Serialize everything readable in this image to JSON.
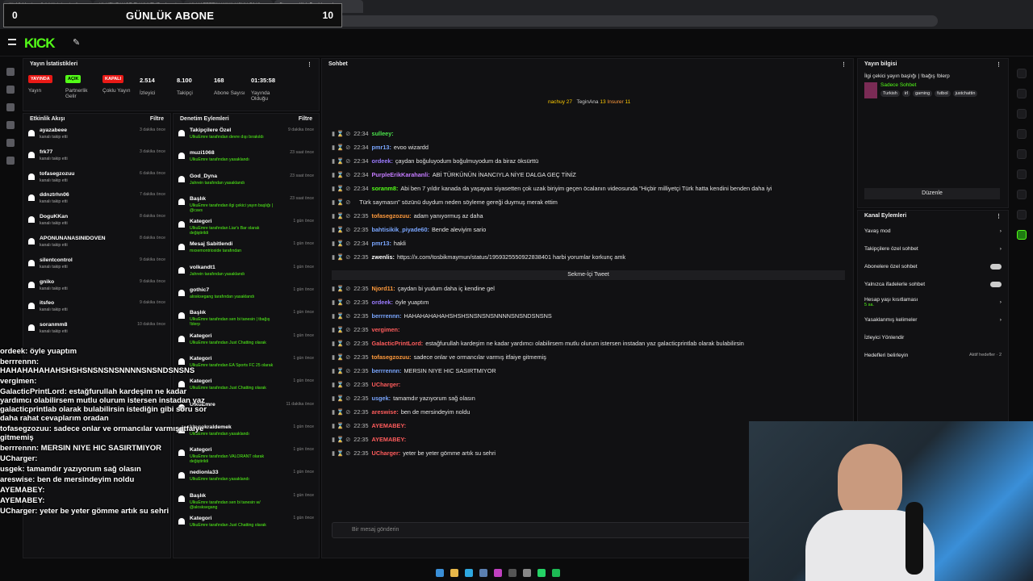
{
  "browser": {
    "tabs": [
      "(1) 13 Meyiren 3.14 Kalabenka ile...",
      "(4) KENZANCE EV KULTUR - Ancak",
      "(4) HAZZETIN KAYA UCYU 5046...",
      "Stream - Kick Dashboard"
    ],
    "url": "https://dashboard.kick.com/stream"
  },
  "overlay": {
    "sub_title": "GÜNLÜK ABONE",
    "sub_left": "0",
    "sub_right": "10"
  },
  "brand": "KICK",
  "stats": {
    "title": "Yayın İstatistikleri",
    "items": [
      {
        "badge": "YAYINDA",
        "badge_color": "#e91916",
        "label": "Yayın"
      },
      {
        "badge": "AÇIK",
        "badge_color": "#53fc18",
        "label": "Partnerlik Gelir"
      },
      {
        "badge": "KAPALI",
        "badge_color": "#e91916",
        "label": "Çoklu Yayın"
      },
      {
        "value": "2.514",
        "label": "İzleyici"
      },
      {
        "value": "8.100",
        "label": "Takipçi"
      },
      {
        "value": "168",
        "label": "Abone Sayısı"
      },
      {
        "value": "01:35:58",
        "label": "Yayında Olduğu"
      }
    ]
  },
  "activity": {
    "title": "Etkinlik Akışı",
    "filter": "Filtre",
    "rows": [
      {
        "name": "ayazabeee",
        "sub": "kanalı takip etti",
        "time": "3 dakika önce"
      },
      {
        "name": "frk77",
        "sub": "kanalı takip etti",
        "time": "3 dakika önce"
      },
      {
        "name": "tofasegzozuu",
        "sub": "kanalı takip etti",
        "time": "6 dakika önce"
      },
      {
        "name": "ddnztrhn06",
        "sub": "kanalı takip etti",
        "time": "7 dakika önce"
      },
      {
        "name": "DoguKKan",
        "sub": "kanalı takip etti",
        "time": "8 dakika önce"
      },
      {
        "name": "APONUNANASINIDOVEN",
        "sub": "kanalı takip etti",
        "time": "8 dakika önce"
      },
      {
        "name": "silentcontrol",
        "sub": "kanalı takip etti",
        "time": "9 dakika önce"
      },
      {
        "name": "gniko",
        "sub": "kanalı takip etti",
        "time": "9 dakika önce"
      },
      {
        "name": "itsfeo",
        "sub": "kanalı takip etti",
        "time": "9 dakika önce"
      },
      {
        "name": "soranmm8",
        "sub": "kanalı takip etti",
        "time": "10 dakika önce"
      }
    ]
  },
  "moderation": {
    "title": "Denetim Eylemleri",
    "filter": "Filtre",
    "rows": [
      {
        "name": "Takipçilere Özel",
        "sub": "UlkuEmre tarafından devre dışı bırakıldı",
        "time": "9 dakika önce"
      },
      {
        "name": "muzi1068",
        "sub": "UlkuEmre tarafından yasaklandı",
        "time": "23 saat önce"
      },
      {
        "name": "God_Dyna",
        "sub": "Jahrein tarafından yasaklandı",
        "time": "23 saat önce"
      },
      {
        "name": "Başlık",
        "sub": "UlkuEmre tarafından ilgi çekici yayın başlığı | @cavs",
        "time": "23 saat önce"
      },
      {
        "name": "Kategori",
        "sub": "UlkuEmre tarafından Liar's Bar olarak değiştirildi",
        "time": "1 gün önce"
      },
      {
        "name": "Mesaj Sabitlendi",
        "sub": "mxxemontrioxide tarafından",
        "time": "1 gün önce"
      },
      {
        "name": "volkandt1",
        "sub": "Jahrein tarafından yasaklandı",
        "time": "1 gün önce"
      },
      {
        "name": "gothic7",
        "sub": "alosksegang tarafından yasaklandı",
        "time": "1 gün önce"
      },
      {
        "name": "Başlık",
        "sub": "UlkuEmre tarafından sen bi tanesin | tbağış !blerp",
        "time": "1 gün önce"
      },
      {
        "name": "Kategori",
        "sub": "UlkuEmre tarafından Just Chatting olarak",
        "time": "1 gün önce"
      },
      {
        "name": "Kategori",
        "sub": "UlkuEmre tarafından EA Sports FC 25 olarak",
        "time": "1 gün önce"
      },
      {
        "name": "Kategori",
        "sub": "UlkuEmre tarafından Just Chatting olarak",
        "time": "1 gün önce"
      },
      {
        "name": "UlkuEmre",
        "sub": "",
        "time": "11 dakika önce"
      },
      {
        "name": "kingokraldemek",
        "sub": "UlkuEmre tarafından yasaklandı",
        "time": "1 gün önce"
      },
      {
        "name": "Kategori",
        "sub": "UlkuEmre tarafından VALORANT olarak değiştirildi",
        "time": "1 gün önce"
      },
      {
        "name": "nedionla33",
        "sub": "UlkuEmre tarafından yasaklandı",
        "time": "1 gün önce"
      },
      {
        "name": "Başlık",
        "sub": "UlkuEmre tarafından sen bi tanesin w/ @alosksegang",
        "time": "1 gün önce"
      },
      {
        "name": "Kategori",
        "sub": "UlkuEmre tarafından Just Chatting olarak",
        "time": "1 gün önce"
      }
    ]
  },
  "chat": {
    "title": "Sohbet",
    "pinned": {
      "a": "nachuy",
      "b": "27",
      "c": "TeginAna",
      "d": "13",
      "e": "Insurer",
      "f": "11"
    },
    "tweet": "Sekme-İçi Tweet",
    "input_placeholder": "Bir mesaj gönderin",
    "messages": [
      {
        "t": "22:34",
        "u": "sulleey:",
        "uc": "#4be34b",
        "m": ""
      },
      {
        "t": "22:34",
        "u": "pmr13:",
        "uc": "#7aa6ff",
        "m": "evoo wizardd"
      },
      {
        "t": "22:34",
        "u": "ordeek:",
        "uc": "#9b7bff",
        "m": "çaydan boğuluyodum boğulmuyodum da biraz öksürttü"
      },
      {
        "t": "22:34",
        "u": "PurpleErikKarahanli:",
        "uc": "#c47bff",
        "m": "ABİ TÜRKÜNÜN İNANCIYLA NİYE DALGA GEÇ TİNİZ"
      },
      {
        "t": "22:34",
        "u": "soranm8:",
        "uc": "#53fc18",
        "m": "Abi ben 7 yıldır kanada da yaşayan siyasetten çok uzak biriyim geçen öcalanın videosunda \"Hiçbir milliyetçi Türk hatta kendini benden daha iyi"
      },
      {
        "t": "",
        "u": "",
        "uc": "#fff",
        "m": "Türk saymasın\" sözünü duydum neden söyleme gereği duymuş merak ettim"
      },
      {
        "t": "22:35",
        "u": "tofasegzozuu:",
        "uc": "#ff9a3c",
        "m": "adam yanıyormuş az daha"
      },
      {
        "t": "22:35",
        "u": "bahtisikik_piyade60:",
        "uc": "#7aa6ff",
        "m": "Bende aleviyim sario"
      },
      {
        "t": "22:34",
        "u": "pmr13:",
        "uc": "#7aa6ff",
        "m": "hakli"
      },
      {
        "t": "22:35",
        "u": "zwenlis:",
        "uc": "#fff",
        "m": "https://x.com/tosbikmaymun/status/1959325550922838401 harbi yorumlar korkunç amk"
      },
      {
        "t": "22:35",
        "u": "Njord11:",
        "uc": "#ff9a3c",
        "m": "çaydan bi yudum daha iç kendine gel"
      },
      {
        "t": "22:35",
        "u": "ordeek:",
        "uc": "#9b7bff",
        "m": "öyle yuaptım"
      },
      {
        "t": "22:35",
        "u": "berrrennn:",
        "uc": "#7aa6ff",
        "m": "HAHAHAHAHAHSHSHSNSNSNSNNNNSNSNDSNSNS"
      },
      {
        "t": "22:35",
        "u": "vergimen:",
        "uc": "#ff5c5c",
        "m": ""
      },
      {
        "t": "22:35",
        "u": "GalacticPrintLord:",
        "uc": "#ff5c5c",
        "m": "estağfurullah kardeşim ne kadar yardımcı olabilirsem mutlu olurum istersen instadan yaz galacticprintlab olarak bulabilirsin"
      },
      {
        "t": "22:35",
        "u": "tofasegzozuu:",
        "uc": "#ff9a3c",
        "m": "sadece onlar ve ormancılar varmış itfaiye gitmemiş"
      },
      {
        "t": "22:35",
        "u": "berrrennn:",
        "uc": "#7aa6ff",
        "m": "MERSIN NIYE HIC SASIRTMIYOR"
      },
      {
        "t": "22:35",
        "u": "UCharger:",
        "uc": "#ff5c5c",
        "m": ""
      },
      {
        "t": "22:35",
        "u": "usgek:",
        "uc": "#7aa6ff",
        "m": "tamamdır yazıyorum sağ olasın"
      },
      {
        "t": "22:35",
        "u": "areswise:",
        "uc": "#ff5c5c",
        "m": "ben de mersindeyim noldu"
      },
      {
        "t": "22:35",
        "u": "AYEMABEY:",
        "uc": "#ff5c5c",
        "m": ""
      },
      {
        "t": "22:35",
        "u": "AYEMABEY:",
        "uc": "#ff5c5c",
        "m": ""
      },
      {
        "t": "22:35",
        "u": "UCharger:",
        "uc": "#ff5c5c",
        "m": "yeter be yeter gömme artık su sehri"
      }
    ]
  },
  "info": {
    "title": "Yayın bilgisi",
    "stream_title": "İlgi çekici yayın başlığı | !bağış !blerp",
    "mode": "Sadece Sohbet",
    "tags": [
      "Turkish",
      "irl",
      "gaming",
      "futbol",
      "justchattin"
    ],
    "edit": "Düzenle"
  },
  "channel": {
    "title": "Kanal Eylemleri",
    "rows": [
      "Yavaş mod",
      "Takipçilere özel sohbet",
      "Abonelere özel sohbet",
      "Yalnızca ifadelerle sohbet",
      "Hesap yaşı kısıtlaması",
      "Yasaklanmış kelimeler",
      "İzleyici Yönlendir",
      "Hedefleri belirleyin"
    ],
    "sub_row": "5 sa.",
    "goal_tag": "Aktif hedefler · 2"
  },
  "overlay_chat": [
    "ordeek: öyle yuaptım",
    "berrrennn: HAHAHAHAHAHSHSHSNSNSNSNNNNSNSNDSNSNS",
    "vergimen:",
    "GalacticPrintLord: estağfurullah kardeşim ne kadar yardımcı olabilirsem mutlu olurum istersen instadan yaz galacticprintlab olarak bulabilirsin istediğin gibi soru sor daha rahat cevaplarım oradan",
    "tofasegzozuu: sadece onlar ve ormancılar varmış itfaiye gitmemiş",
    "berrrennn: MERSIN NIYE HIC SASIRTMIYOR",
    "UCharger:",
    "usgek: tamamdır yazıyorum sağ olasın",
    "areswise: ben de mersindeyim noldu",
    "AYEMABEY:",
    "AYEMABEY:",
    "UCharger: yeter be yeter gömme artık su sehri"
  ]
}
